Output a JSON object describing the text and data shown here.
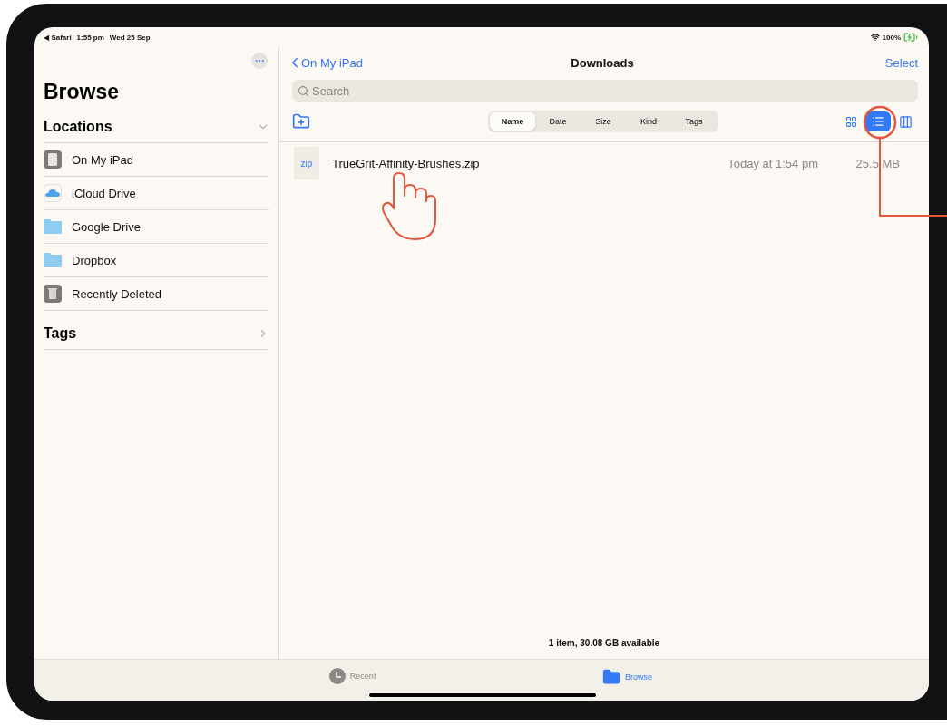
{
  "status_bar": {
    "back_label": "◀ Safari",
    "time": "1:55 pm",
    "date": "Wed 25 Sep",
    "battery": "100%"
  },
  "sidebar": {
    "title": "Browse",
    "sections": [
      {
        "title": "Locations",
        "expanded": true,
        "items": [
          {
            "label": "On My iPad",
            "kind": "ipad"
          },
          {
            "label": "iCloud Drive",
            "kind": "icloud"
          },
          {
            "label": "Google Drive",
            "kind": "folder"
          },
          {
            "label": "Dropbox",
            "kind": "folder"
          },
          {
            "label": "Recently Deleted",
            "kind": "trash"
          }
        ]
      },
      {
        "title": "Tags",
        "expanded": false
      }
    ]
  },
  "header": {
    "back": "On My iPad",
    "title": "Downloads",
    "action": "Select"
  },
  "search": {
    "placeholder": "Search"
  },
  "sort_tabs": [
    {
      "label": "Name",
      "selected": true
    },
    {
      "label": "Date",
      "selected": false
    },
    {
      "label": "Size",
      "selected": false
    },
    {
      "label": "Kind",
      "selected": false
    },
    {
      "label": "Tags",
      "selected": false
    }
  ],
  "view_modes": [
    {
      "kind": "grid",
      "selected": false
    },
    {
      "kind": "list",
      "selected": true
    },
    {
      "kind": "columns",
      "selected": false
    }
  ],
  "files": [
    {
      "type_label": "zip",
      "name": "TrueGrit-Affinity-Brushes.zip",
      "modified": "Today at 1:54 pm",
      "size": "25.5 MB"
    }
  ],
  "footer": "1 item, 30.08 GB available",
  "tab_bar": [
    {
      "label": "Recent",
      "kind": "recent",
      "selected": false
    },
    {
      "label": "Browse",
      "kind": "browse",
      "selected": true
    }
  ]
}
